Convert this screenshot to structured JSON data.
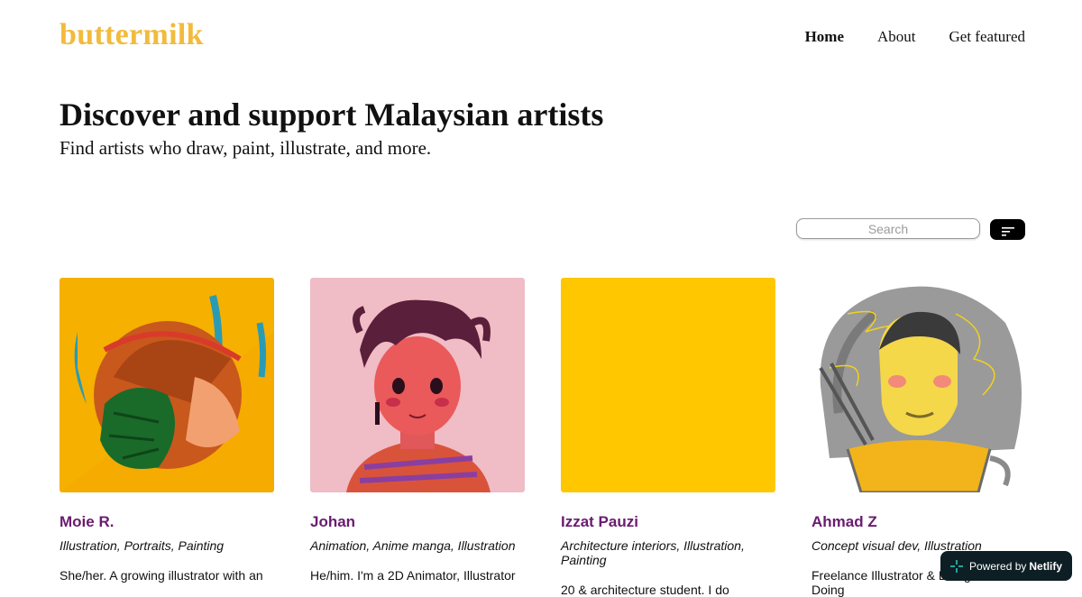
{
  "site": {
    "logo": "buttermilk"
  },
  "nav": {
    "items": [
      "Home",
      "About",
      "Get featured"
    ],
    "active": "Home"
  },
  "hero": {
    "title": "Discover and support Malaysian artists",
    "subtitle": "Find artists who draw, paint, illustrate, and more."
  },
  "search": {
    "placeholder": "Search",
    "value": ""
  },
  "sort_button": {
    "icon": "sort-lines-icon"
  },
  "artists": [
    {
      "name": "Moie R.",
      "tags": "Illustration, Portraits, Painting",
      "bio": "She/her. A growing illustrator with an",
      "image": "illustrated-girl-with-monstera-leaf",
      "image_bg": "#f5b000"
    },
    {
      "name": "Johan",
      "tags": "Animation, Anime manga, Illustration",
      "bio": "He/him. I'm a 2D Animator, Illustrator",
      "image": "anime-boy-portrait",
      "image_bg": "#f0bcc5"
    },
    {
      "name": "Izzat Pauzi",
      "tags": "Architecture interiors, Illustration, Painting",
      "bio": "20 & architecture student. I do",
      "image": "placeholder-yellow",
      "image_bg": "#ffc700"
    },
    {
      "name": "Ahmad Z",
      "tags": "Concept visual dev, Illustration",
      "bio": "Freelance Illustrator & Designer. Doing",
      "image": "man-in-noodle-cup-portrait",
      "image_bg": "#ffffff"
    }
  ],
  "badge": {
    "prefix": "Powered by",
    "brand": "Netlify"
  },
  "colors": {
    "logo": "#f2bb3c",
    "artist_name": "#6a1b6f",
    "badge_bg": "#0e1e25"
  }
}
